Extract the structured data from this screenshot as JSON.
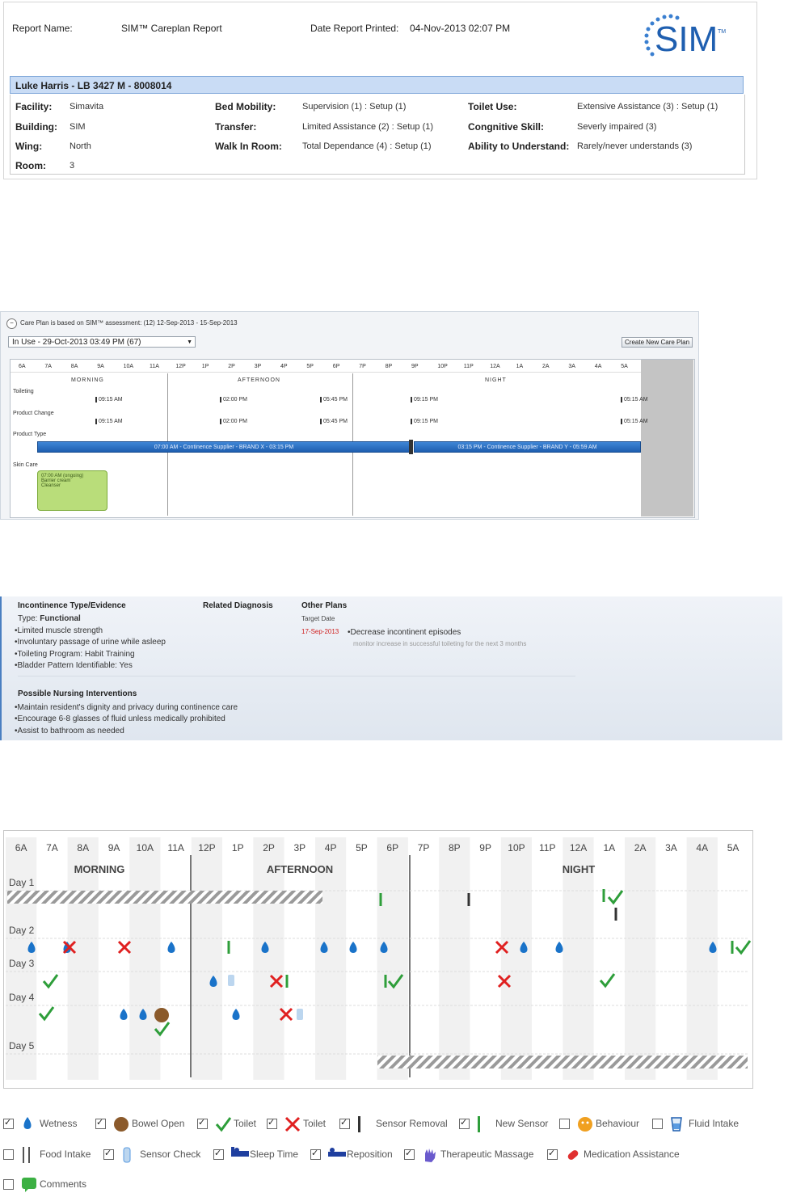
{
  "header": {
    "report_name_label": "Report Name:",
    "report_name": "SIM™ Careplan Report",
    "date_printed_label": "Date Report Printed:",
    "date_printed": "04-Nov-2013 02:07 PM",
    "logo_text": "SIM",
    "logo_tm": "TM",
    "patient": "Luke Harris - LB 3427 M - 8008014",
    "fields": {
      "facility_label": "Facility:",
      "facility": "Simavita",
      "building_label": "Building:",
      "building": "SIM",
      "wing_label": "Wing:",
      "wing": "North",
      "room_label": "Room:",
      "room": "3",
      "bed_mobility_label": "Bed Mobility:",
      "bed_mobility": "Supervision (1) : Setup (1)",
      "transfer_label": "Transfer:",
      "transfer": "Limited Assistance (2) : Setup (1)",
      "walk_label": "Walk In Room:",
      "walk": "Total Dependance (4) : Setup (1)",
      "toilet_label": "Toilet Use:",
      "toilet": "Extensive Assistance (3) : Setup (1)",
      "cognitive_label": "Congnitive Skill:",
      "cognitive": "Severly impaired (3)",
      "understand_label": "Ability to Understand:",
      "understand": "Rarely/never understands (3)"
    }
  },
  "careplan": {
    "basis": "Care Plan is based on SIM™ assessment: (12) 12-Sep-2013 - 15-Sep-2013",
    "in_use": "In Use - 29-Oct-2013 03:49 PM (67)",
    "create_button": "Create New Care Plan",
    "hours": [
      "6A",
      "7A",
      "8A",
      "9A",
      "10A",
      "11A",
      "12P",
      "1P",
      "2P",
      "3P",
      "4P",
      "5P",
      "6P",
      "7P",
      "8P",
      "9P",
      "10P",
      "11P",
      "12A",
      "1A",
      "2A",
      "3A",
      "4A",
      "5A"
    ],
    "periods": {
      "morning": "MORNING",
      "afternoon": "AFTERNOON",
      "night": "NIGHT"
    },
    "rows": {
      "toileting": "Toileting",
      "product_change": "Product Change",
      "product_type": "Product Type",
      "skin_care": "Skin Care"
    },
    "times": {
      "t1": "09:15 AM",
      "t2": "02:00 PM",
      "t3": "05:45 PM",
      "t4": "09:15 PM",
      "t5": "05:15 AM"
    },
    "bar1": "07:00 AM - Continence Supplier - BRAND X - 03:15 PM",
    "bar2": "03:15 PM - Continence Supplier - BRAND Y - 05:59 AM",
    "skin_box": {
      "l1": "07:00 AM (ongoing)",
      "l2": "Barrier cream",
      "l3": "Cleanser"
    }
  },
  "evidence": {
    "col1_title": "Incontinence Type/Evidence",
    "type_label": "Type:",
    "type_value": "Functional",
    "bullets": [
      "Limited muscle strength",
      "Involuntary passage of urine while asleep",
      "Toileting Program:  Habit Training",
      "Bladder Pattern Identifiable:  Yes"
    ],
    "col2_title": "Related Diagnosis",
    "col3_title": "Other Plans",
    "target_date_label": "Target Date",
    "target_date": "17-Sep-2013",
    "goal": "Decrease incontinent episodes",
    "goal_detail": "monitor increase in successful toileting for the next 3 months",
    "interventions_title": "Possible Nursing Interventions",
    "interventions": [
      "Maintain resident's dignity and privacy during continence care",
      "Encourage 6-8 glasses of fluid unless medically prohibited",
      "Assist to bathroom as needed"
    ]
  },
  "chart": {
    "hours": [
      "6A",
      "7A",
      "8A",
      "9A",
      "10A",
      "11A",
      "12P",
      "1P",
      "2P",
      "3P",
      "4P",
      "5P",
      "6P",
      "7P",
      "8P",
      "9P",
      "10P",
      "11P",
      "12A",
      "1A",
      "2A",
      "3A",
      "4A",
      "5A"
    ],
    "periods": {
      "morning": "MORNING",
      "afternoon": "AFTERNOON",
      "night": "NIGHT"
    },
    "days": [
      "Day 1",
      "Day 2",
      "Day 3",
      "Day 4",
      "Day 5"
    ]
  },
  "legend": {
    "items": [
      {
        "label": "Wetness",
        "checked": true
      },
      {
        "label": "Bowel Open",
        "checked": true
      },
      {
        "label": "Toilet",
        "checked": true
      },
      {
        "label": "Toilet",
        "checked": true
      },
      {
        "label": "Sensor Removal",
        "checked": true
      },
      {
        "label": "New Sensor",
        "checked": true
      },
      {
        "label": "Behaviour",
        "checked": false
      },
      {
        "label": "Fluid Intake",
        "checked": false
      },
      {
        "label": "Food Intake",
        "checked": false
      },
      {
        "label": "Sensor Check",
        "checked": true
      },
      {
        "label": "Sleep Time",
        "checked": true
      },
      {
        "label": "Reposition",
        "checked": true
      },
      {
        "label": "Therapeutic Massage",
        "checked": true
      },
      {
        "label": "Medication Assistance",
        "checked": true
      },
      {
        "label": "Comments",
        "checked": false
      }
    ]
  },
  "colors": {
    "wetness": "#1a73c9",
    "bowel": "#8b5a2b",
    "toilet_ok": "#2e9e3a",
    "toilet_fail": "#e02020",
    "accent": "#1f5fb0"
  }
}
